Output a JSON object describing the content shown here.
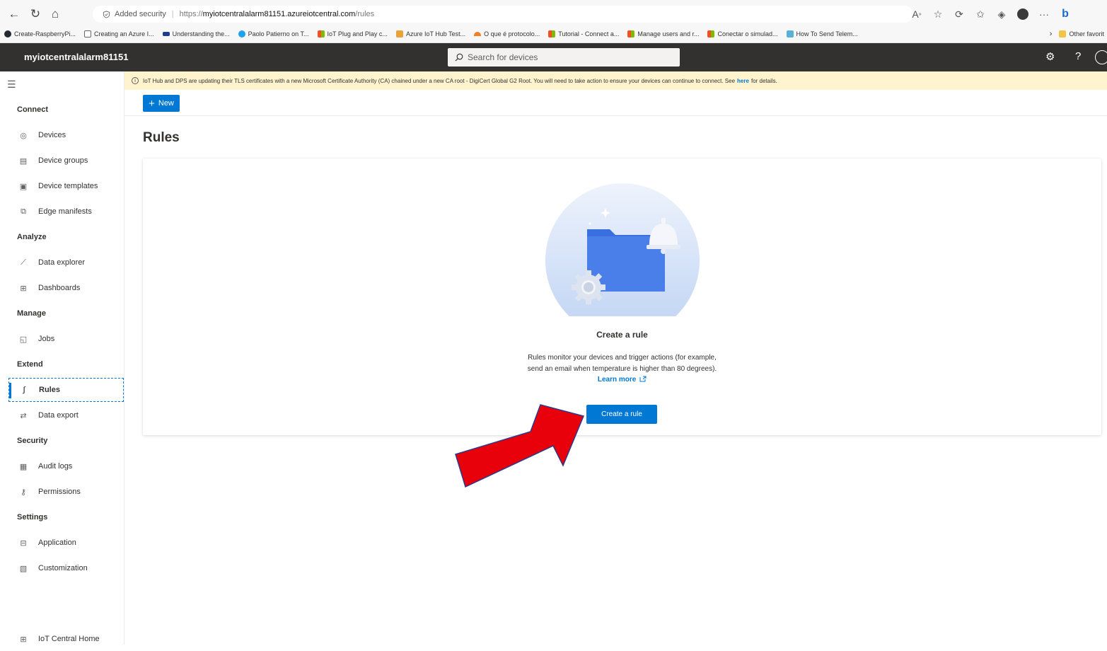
{
  "browser": {
    "security_label": "Added security",
    "url_prefix": "https://",
    "url_host": "myiotcentralalarm81151.azureiotcentral.com",
    "url_path": "/rules",
    "bookmarks": [
      {
        "label": "Create-RaspberryPi...",
        "color": "#24292e"
      },
      {
        "label": "Creating an Azure I...",
        "color": "#ffffff"
      },
      {
        "label": "Understanding the...",
        "color": "#1f3a93"
      },
      {
        "label": "Paolo Patierno on T...",
        "color": "#1da1f2"
      },
      {
        "label": "IoT Plug and Play c...",
        "color": "#f25022"
      },
      {
        "label": "Azure IoT Hub Test...",
        "color": "#e8a23a"
      },
      {
        "label": "O que é protocolo...",
        "color": "#f38020"
      },
      {
        "label": "Tutorial - Connect a...",
        "color": "#f25022"
      },
      {
        "label": "Manage users and r...",
        "color": "#f25022"
      },
      {
        "label": "Conectar o simulad...",
        "color": "#f25022"
      },
      {
        "label": "How To Send Telem...",
        "color": "#5bb0d8"
      }
    ],
    "other_favorites": "Other favorit"
  },
  "app": {
    "name": "myiotcentralalarm81151",
    "search_placeholder": "Search for devices"
  },
  "banner": {
    "text": "IoT Hub and DPS are updating their TLS certificates with a new Microsoft Certificate Authority (CA) chained under a new CA root - DigiCert Global G2 Root. You will need to take action to ensure your devices can continue to connect. See",
    "link": "here",
    "suffix": "for details."
  },
  "toolbar": {
    "new_label": "New"
  },
  "sidebar": {
    "sections": {
      "connect": "Connect",
      "analyze": "Analyze",
      "manage": "Manage",
      "extend": "Extend",
      "security": "Security",
      "settings": "Settings"
    },
    "items": {
      "devices": "Devices",
      "device_groups": "Device groups",
      "device_templates": "Device templates",
      "edge_manifests": "Edge manifests",
      "data_explorer": "Data explorer",
      "dashboards": "Dashboards",
      "jobs": "Jobs",
      "rules": "Rules",
      "data_export": "Data export",
      "audit_logs": "Audit logs",
      "permissions": "Permissions",
      "application": "Application",
      "customization": "Customization",
      "iot_central_home": "IoT Central Home"
    }
  },
  "main": {
    "title": "Rules",
    "empty": {
      "title": "Create a rule",
      "desc_line1": "Rules monitor your devices and trigger actions (for example,",
      "desc_line2": "send an email when temperature is higher than 80 degrees).",
      "learn_more": "Learn more",
      "button": "Create a rule"
    }
  },
  "colors": {
    "accent": "#0078d4",
    "appbar": "#323130",
    "banner": "#fff4ce",
    "arrow": "#e8000b"
  }
}
